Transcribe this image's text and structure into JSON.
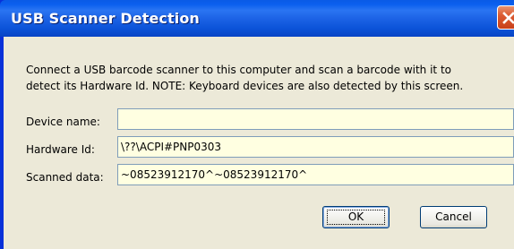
{
  "window": {
    "title": "USB Scanner Detection"
  },
  "message": {
    "line1": "Connect a USB barcode scanner to this computer and scan a barcode with it to",
    "line2": "detect its Hardware Id. NOTE: Keyboard devices are also detected by this screen."
  },
  "fields": {
    "device_name": {
      "label": "Device name:",
      "value": ""
    },
    "hardware_id": {
      "label": "Hardware Id:",
      "value": "\\??\\ACPI#PNP0303"
    },
    "scanned_data": {
      "label": "Scanned data:",
      "value": "~08523912170^~08523912170^"
    }
  },
  "buttons": {
    "ok": "OK",
    "cancel": "Cancel"
  },
  "colors": {
    "titlebar": "#0b5fee",
    "dialog_bg": "#ece9d8",
    "field_bg": "#ffffe1",
    "close_btn": "#dc5b32"
  },
  "icons": {
    "close": "close-icon"
  }
}
